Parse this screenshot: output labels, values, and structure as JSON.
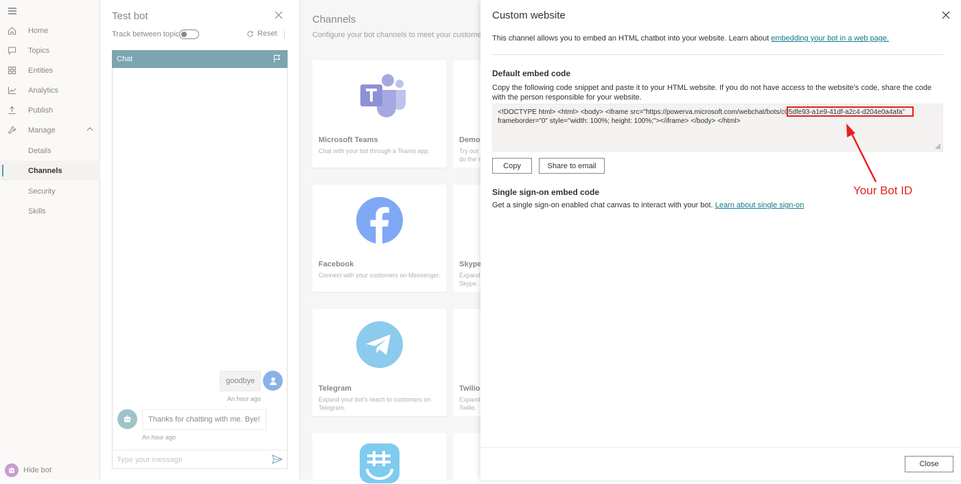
{
  "nav": {
    "items": [
      {
        "label": "Home",
        "icon": "home-icon"
      },
      {
        "label": "Topics",
        "icon": "chat-icon"
      },
      {
        "label": "Entities",
        "icon": "entities-icon"
      },
      {
        "label": "Analytics",
        "icon": "analytics-icon"
      },
      {
        "label": "Publish",
        "icon": "publish-icon"
      },
      {
        "label": "Manage",
        "icon": "wrench-icon"
      }
    ],
    "sub_items": [
      {
        "label": "Details"
      },
      {
        "label": "Channels",
        "active": true
      },
      {
        "label": "Security"
      },
      {
        "label": "Skills"
      }
    ],
    "hide_bot": "Hide bot"
  },
  "testbot": {
    "title": "Test bot",
    "track_label": "Track between topics",
    "reset_label": "Reset",
    "chat_header": "Chat",
    "user_message": "goodbye",
    "user_time": "An hour ago",
    "bot_message": "Thanks for chatting with me. Bye!",
    "bot_time": "An hour ago",
    "input_placeholder": "Type your message"
  },
  "channels": {
    "title": "Channels",
    "subtitle": "Configure your bot channels to meet your customers where they are.",
    "cards": [
      {
        "name": "Microsoft Teams",
        "desc": "Chat with your bot through a Teams app."
      },
      {
        "name": "Facebook",
        "desc": "Connect with your customers on Messenger."
      },
      {
        "name": "Telegram",
        "desc": "Expand your bot's reach to customers on Telegram."
      }
    ],
    "cards_right": [
      {
        "name": "Demo website",
        "desc1": "Try out",
        "desc2": "do the s"
      },
      {
        "name": "Skype",
        "desc1": "Expand",
        "desc2": "Skype."
      },
      {
        "name": "Twilio",
        "desc1": "Expand",
        "desc2": "Twilio."
      }
    ]
  },
  "panel": {
    "title": "Custom website",
    "intro": "This channel allows you to embed an HTML chatbot into your website. Learn about ",
    "intro_link": "embedding your bot in a web page.",
    "embed_heading": "Default embed code",
    "embed_instructions": "Copy the following code snippet and paste it to your HTML website. If you do not have access to the website's code, share the code with the person responsible for your website.",
    "code_prefix": "<!DOCTYPE html> <html> <body> <iframe src=\"https://powerva.microsoft.com/webchat/bots/",
    "bot_id": "c05dfe93-a1e9-41df-a2c4-d204e0a4afa",
    "code_suffix": "\" frameborder=\"0\" style=\"width: 100%; height: 100%;\"></iframe> </body> </html>",
    "copy_button": "Copy",
    "share_button": "Share to email",
    "sso_heading": "Single sign-on embed code",
    "sso_text": "Get a single sign-on enabled chat canvas to interact with your bot. ",
    "sso_link": "Learn about single sign-on",
    "close_button": "Close"
  },
  "annotation": {
    "label": "Your Bot ID",
    "color": "#e8201c"
  }
}
